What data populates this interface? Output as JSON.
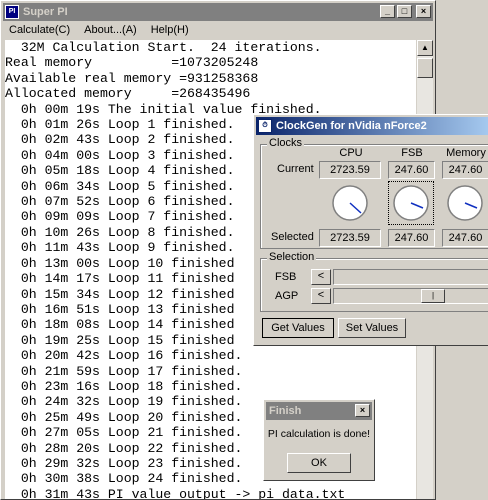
{
  "superpi": {
    "title": "Super PI",
    "menu": [
      "Calculate(C)",
      "About...(A)",
      "Help(H)"
    ],
    "lines": [
      "  32M Calculation Start.  24 iterations.",
      "Real memory          =1073205248",
      "Available real memory =931258368",
      "Allocated memory     =268435496",
      "  0h 00m 19s The initial value finished.",
      "  0h 01m 26s Loop 1 finished.",
      "  0h 02m 43s Loop 2 finished.",
      "  0h 04m 00s Loop 3 finished.",
      "  0h 05m 18s Loop 4 finished.",
      "  0h 06m 34s Loop 5 finished.",
      "  0h 07m 52s Loop 6 finished.",
      "  0h 09m 09s Loop 7 finished.",
      "  0h 10m 26s Loop 8 finished.",
      "  0h 11m 43s Loop 9 finished.",
      "  0h 13m 00s Loop 10 finished",
      "  0h 14m 17s Loop 11 finished",
      "  0h 15m 34s Loop 12 finished",
      "  0h 16m 51s Loop 13 finished",
      "  0h 18m 08s Loop 14 finished",
      "  0h 19m 25s Loop 15 finished",
      "  0h 20m 42s Loop 16 finished.",
      "  0h 21m 59s Loop 17 finished.",
      "  0h 23m 16s Loop 18 finished.",
      "  0h 24m 32s Loop 19 finished.",
      "  0h 25m 49s Loop 20 finished.",
      "  0h 27m 05s Loop 21 finished.",
      "  0h 28m 20s Loop 22 finished.",
      "  0h 29m 32s Loop 23 finished.",
      "  0h 30m 38s Loop 24 finished.",
      "  0h 31m 43s PI value output -> pi_data.txt"
    ]
  },
  "clockgen": {
    "title": "ClockGen for nVidia nForce2",
    "clocks_label": "Clocks",
    "headers": [
      "CPU",
      "FSB",
      "Memory"
    ],
    "current_label": "Current",
    "selected_label": "Selected",
    "current": [
      "2723.59",
      "247.60",
      "247.60"
    ],
    "selected": [
      "2723.59",
      "247.60",
      "247.60"
    ],
    "selection_label": "Selection",
    "fsb_label": "FSB",
    "agp_label": "AGP",
    "get_values": "Get Values",
    "set_values": "Set Values"
  },
  "finish": {
    "title": "Finish",
    "message": "PI calculation is done!",
    "ok": "OK"
  },
  "colors": {
    "active_title": "#0a246a",
    "inactive_title": "#808080",
    "face": "#d4d0c8"
  }
}
